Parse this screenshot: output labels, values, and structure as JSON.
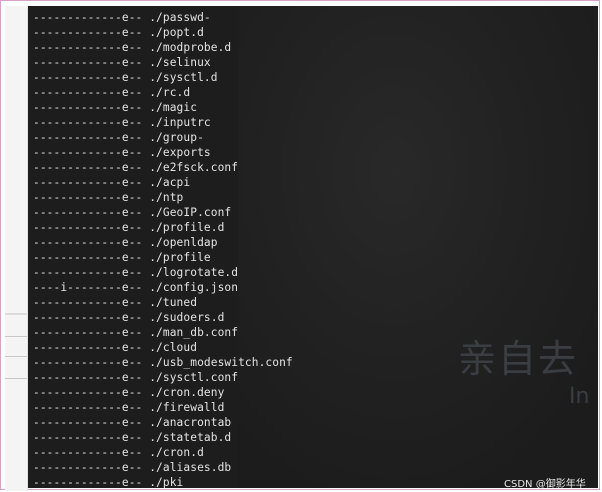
{
  "terminal": {
    "lines": [
      {
        "attr": "-------------e--",
        "path": "./passwd-"
      },
      {
        "attr": "-------------e--",
        "path": "./popt.d"
      },
      {
        "attr": "-------------e--",
        "path": "./modprobe.d"
      },
      {
        "attr": "-------------e--",
        "path": "./selinux"
      },
      {
        "attr": "-------------e--",
        "path": "./sysctl.d"
      },
      {
        "attr": "-------------e--",
        "path": "./rc.d"
      },
      {
        "attr": "-------------e--",
        "path": "./magic"
      },
      {
        "attr": "-------------e--",
        "path": "./inputrc"
      },
      {
        "attr": "-------------e--",
        "path": "./group-"
      },
      {
        "attr": "-------------e--",
        "path": "./exports"
      },
      {
        "attr": "-------------e--",
        "path": "./e2fsck.conf"
      },
      {
        "attr": "-------------e--",
        "path": "./acpi"
      },
      {
        "attr": "-------------e--",
        "path": "./ntp"
      },
      {
        "attr": "-------------e--",
        "path": "./GeoIP.conf"
      },
      {
        "attr": "-------------e--",
        "path": "./profile.d"
      },
      {
        "attr": "-------------e--",
        "path": "./openldap"
      },
      {
        "attr": "-------------e--",
        "path": "./profile"
      },
      {
        "attr": "-------------e--",
        "path": "./logrotate.d"
      },
      {
        "attr": "----i--------e--",
        "path": "./config.json"
      },
      {
        "attr": "-------------e--",
        "path": "./tuned"
      },
      {
        "attr": "-------------e--",
        "path": "./sudoers.d"
      },
      {
        "attr": "-------------e--",
        "path": "./man_db.conf"
      },
      {
        "attr": "-------------e--",
        "path": "./cloud"
      },
      {
        "attr": "-------------e--",
        "path": "./usb_modeswitch.conf"
      },
      {
        "attr": "-------------e--",
        "path": "./sysctl.conf"
      },
      {
        "attr": "-------------e--",
        "path": "./cron.deny"
      },
      {
        "attr": "-------------e--",
        "path": "./firewalld"
      },
      {
        "attr": "-------------e--",
        "path": "./anacrontab"
      },
      {
        "attr": "-------------e--",
        "path": "./statetab.d"
      },
      {
        "attr": "-------------e--",
        "path": "./cron.d"
      },
      {
        "attr": "-------------e--",
        "path": "./aliases.db"
      },
      {
        "attr": "-------------e--",
        "path": "./pki"
      }
    ],
    "background_color": "#1d1d1d",
    "text_color": "#e4e4e4"
  },
  "watermark": {
    "main_text": "亲自去",
    "sub_text": "In"
  },
  "caption": "CSDN @御影年华"
}
